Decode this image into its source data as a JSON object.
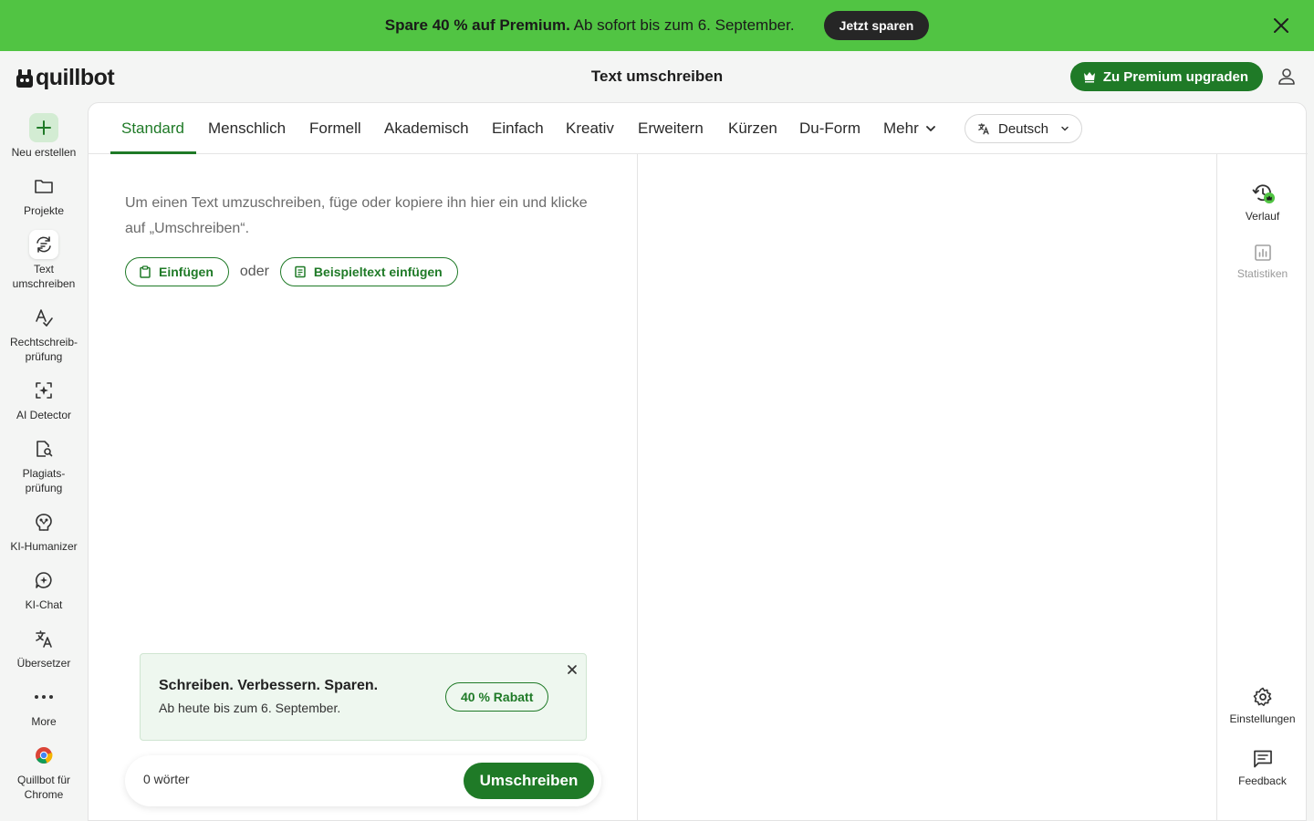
{
  "promo": {
    "bold_text": "Spare 40 % auf Premium.",
    "text": " Ab sofort bis zum 6. September.",
    "cta": "Jetzt sparen"
  },
  "header": {
    "logo": "quillbot",
    "title": "Text umschreiben",
    "premium_label": "Zu Premium upgraden"
  },
  "sidebar": {
    "items": [
      {
        "label": "Neu erstellen",
        "icon": "plus-icon"
      },
      {
        "label": "Projekte",
        "icon": "folder-icon"
      },
      {
        "label": "Text umschreiben",
        "icon": "paraphrase-icon",
        "active": true
      },
      {
        "label": "Rechtschreib-prüfung",
        "icon": "grammar-icon"
      },
      {
        "label": "AI Detector",
        "icon": "ai-detector-icon"
      },
      {
        "label": "Plagiats-prüfung",
        "icon": "plagiarism-icon"
      },
      {
        "label": "KI-Humanizer",
        "icon": "humanizer-icon"
      },
      {
        "label": "KI-Chat",
        "icon": "chat-icon"
      },
      {
        "label": "Übersetzer",
        "icon": "translate-icon"
      },
      {
        "label": "More",
        "icon": "more-icon"
      },
      {
        "label": "Quillbot für Chrome",
        "icon": "chrome-icon"
      }
    ]
  },
  "tabs": {
    "items": [
      "Standard",
      "Menschlich",
      "Formell",
      "Akademisch",
      "Einfach",
      "Kreativ",
      "Erweitern",
      "Kürzen",
      "Du-Form",
      "Mehr"
    ],
    "active": "Standard",
    "language": "Deutsch"
  },
  "editor": {
    "placeholder": "Um einen Text umzuschreiben, füge oder kopiere ihn hier ein und klicke auf „Umschreiben“.",
    "paste_label": "Einfügen",
    "or_label": "oder",
    "sample_label": "Beispieltext einfügen",
    "word_count": "0 wörter",
    "rephrase_label": "Umschreiben"
  },
  "discount": {
    "title": "Schreiben. Verbessern. Sparen.",
    "subtitle": "Ab heute bis zum 6. September.",
    "badge": "40 % Rabatt"
  },
  "rail": {
    "history": "Verlauf",
    "statistics": "Statistiken",
    "settings": "Einstellungen",
    "feedback": "Feedback"
  },
  "colors": {
    "banner": "#51c443",
    "brand_green": "#1f7a27",
    "dark": "#262626"
  }
}
